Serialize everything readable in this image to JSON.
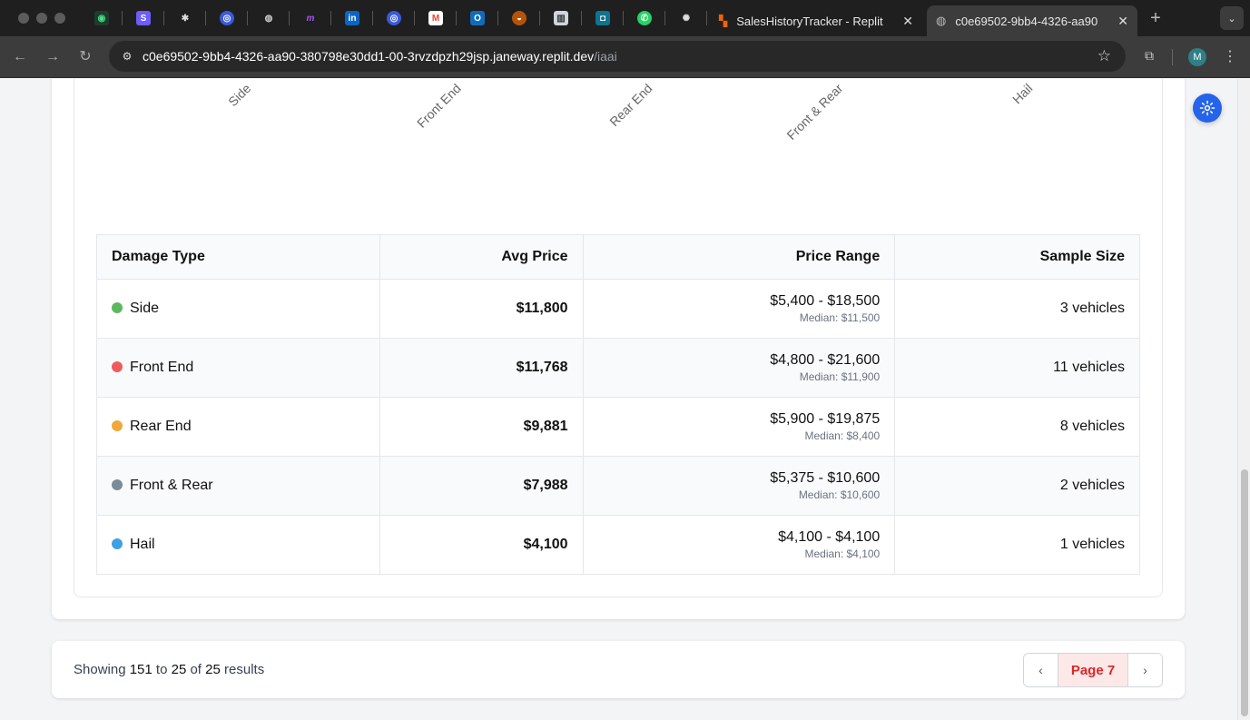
{
  "browser": {
    "tabs": [
      {
        "title": "SalesHistoryTracker - Replit"
      },
      {
        "title": "c0e69502-9bb4-4326-aa90"
      }
    ],
    "url_host": "c0e69502-9bb4-4326-aa90-380798e30dd1-00-3rvzdpzh29jsp.janeway.replit.dev",
    "url_path": "/iaai",
    "profile_initial": "M"
  },
  "chart_labels": [
    "Side",
    "Front End",
    "Rear End",
    "Front & Rear",
    "Hail"
  ],
  "table": {
    "headers": [
      "Damage Type",
      "Avg Price",
      "Price Range",
      "Sample Size"
    ],
    "rows": [
      {
        "type": "Side",
        "color": "#5cb85c",
        "avg": "$11,800",
        "range": "$5,400 - $18,500",
        "median": "Median: $11,500",
        "sample": "3 vehicles"
      },
      {
        "type": "Front End",
        "color": "#ef5b5b",
        "avg": "$11,768",
        "range": "$4,800 - $21,600",
        "median": "Median: $11,900",
        "sample": "11 vehicles"
      },
      {
        "type": "Rear End",
        "color": "#f0a83a",
        "avg": "$9,881",
        "range": "$5,900 - $19,875",
        "median": "Median: $8,400",
        "sample": "8 vehicles"
      },
      {
        "type": "Front & Rear",
        "color": "#7a8b99",
        "avg": "$7,988",
        "range": "$5,375 - $10,600",
        "median": "Median: $10,600",
        "sample": "2 vehicles"
      },
      {
        "type": "Hail",
        "color": "#3ea0e4",
        "avg": "$4,100",
        "range": "$4,100 - $4,100",
        "median": "Median: $4,100",
        "sample": "1 vehicles"
      }
    ]
  },
  "footer": {
    "showing_prefix": "Showing",
    "from": "151",
    "to_word": "to",
    "to": "25",
    "of_word": "of",
    "total": "25",
    "results_word": "results",
    "page_label": "Page 7"
  },
  "colors": {
    "accent": "#2563eb",
    "page_active_bg": "#fde8e8",
    "page_active_text": "#dc2626"
  }
}
